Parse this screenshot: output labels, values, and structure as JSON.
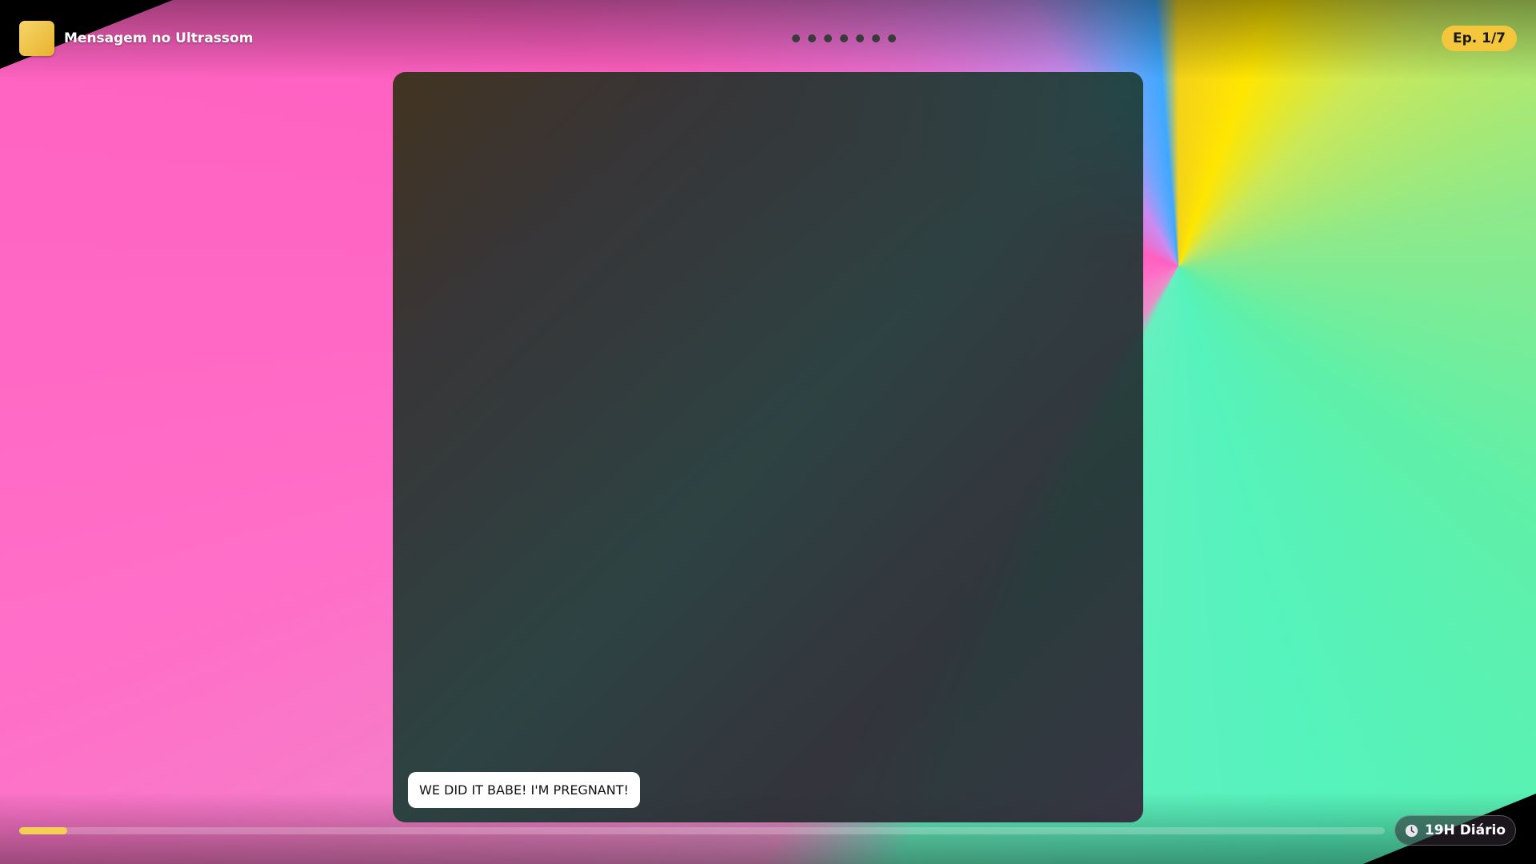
{
  "header": {
    "title": "Mensagem no Ultrassom",
    "episode_badge": "Ep. 1/7",
    "page_dots": [
      1,
      2,
      3,
      4,
      5,
      6,
      7
    ]
  },
  "player": {
    "caption": "WE DID IT BABE! I'M PREGNANT!",
    "progress_percent": 3.5
  },
  "footer": {
    "schedule_label": "19H Diário",
    "schedule_icon": "clock-icon"
  },
  "colors": {
    "accent": "#f4c63c",
    "progress": "#f4cf52"
  }
}
